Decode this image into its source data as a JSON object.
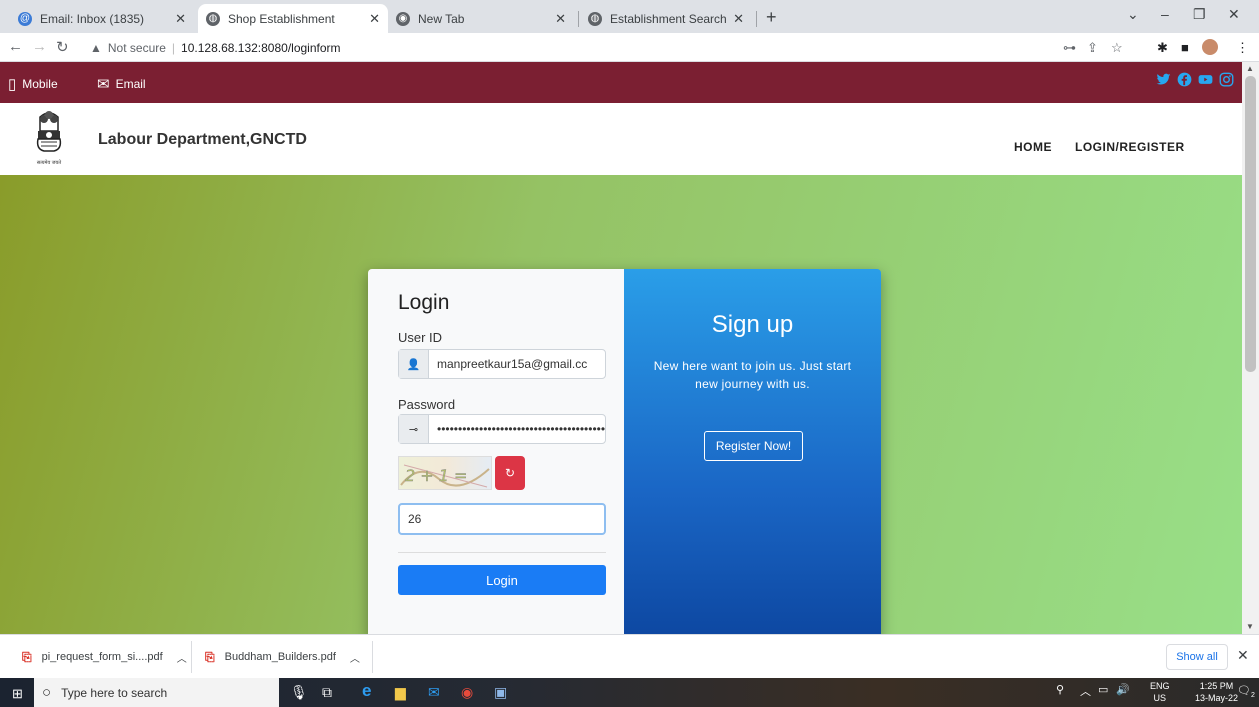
{
  "browser": {
    "tabs": [
      {
        "title": "Email: Inbox (1835)",
        "favicon": "mail-icon",
        "active": false
      },
      {
        "title": "Shop Establishment",
        "favicon": "globe-icon",
        "active": true
      },
      {
        "title": "New Tab",
        "favicon": "chrome-icon",
        "active": false
      },
      {
        "title": "Establishment Search Result",
        "favicon": "globe-icon",
        "active": false
      }
    ],
    "address": {
      "security_label": "Not secure",
      "url": "10.128.68.132:8080/loginform"
    }
  },
  "topbar": {
    "mobile_label": "Mobile",
    "email_label": "Email",
    "social": [
      "twitter-icon",
      "facebook-icon",
      "youtube-icon",
      "instagram-icon"
    ],
    "bg_color": "#7b1f32"
  },
  "header": {
    "emblem_caption": "सत्यमेव जयते",
    "dept_name": "Labour Department,GNCTD",
    "nav": [
      "HOME",
      "LOGIN/REGISTER"
    ]
  },
  "login": {
    "title": "Login",
    "userid_label": "User ID",
    "userid_value": "manpreetkaur15a@gmail.cc",
    "password_label": "Password",
    "password_value": "••••••••••••••••••••••••••••••••••••••••",
    "captcha_text": "2 + 1 =",
    "captcha_answer": "26",
    "login_button": "Login"
  },
  "signup": {
    "title": "Sign up",
    "text": "New here want to join us. Just start new journey with us.",
    "register_button": "Register Now!"
  },
  "downloads": {
    "items": [
      "pi_request_form_si....pdf",
      "Buddham_Builders.pdf"
    ],
    "show_all": "Show all"
  },
  "taskbar": {
    "search_placeholder": "Type here to search",
    "lang_top": "ENG",
    "lang_bottom": "US",
    "time": "1:25 PM",
    "date": "13-May-22",
    "notification_count": "2"
  }
}
